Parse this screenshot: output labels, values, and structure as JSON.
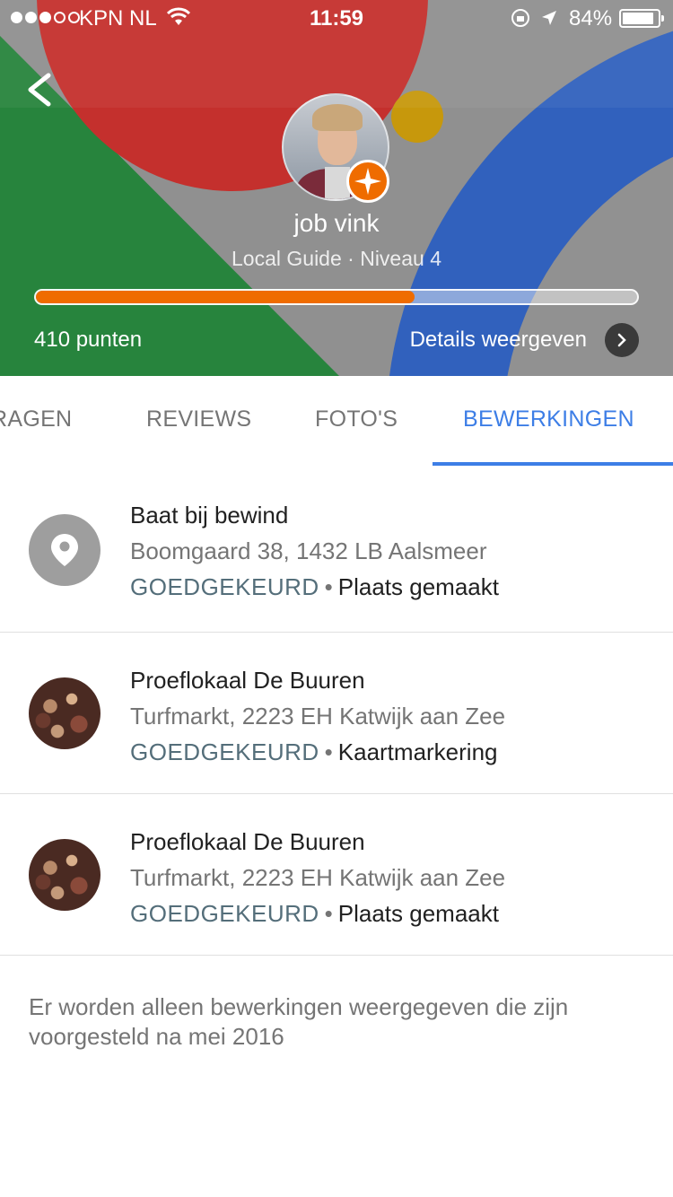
{
  "status_bar": {
    "carrier": "KPN NL",
    "time": "11:59",
    "battery": "84%",
    "battery_level": 0.84
  },
  "profile": {
    "name": "job vink",
    "level": "Local Guide · Niveau 4",
    "progress": 0.63,
    "points": "410 punten",
    "details_link": "Details weergeven",
    "progress_color": "#ef6c00"
  },
  "tabs": [
    {
      "label": "VRAGEN",
      "visible_text": "RAGEN",
      "active": false
    },
    {
      "label": "REVIEWS",
      "active": false
    },
    {
      "label": "FOTO'S",
      "active": false
    },
    {
      "label": "BEWERKINGEN",
      "active": true
    }
  ],
  "accent_color": "#3d7ee6",
  "edits": [
    {
      "title": "Baat bij bewind",
      "address": "Boomgaard 38, 1432 LB Aalsmeer",
      "status": "GOEDGEKEURD",
      "separator": "•",
      "kind": "Plaats gemaakt",
      "icon": "location-pin-icon"
    },
    {
      "title": "Proeflokaal De Buuren",
      "address": "Turfmarkt, 2223 EH Katwijk aan Zee",
      "status": "GOEDGEKEURD",
      "separator": "•",
      "kind": "Kaartmarkering",
      "icon": "place-photo"
    },
    {
      "title": "Proeflokaal De Buuren",
      "address": "Turfmarkt, 2223 EH Katwijk aan Zee",
      "status": "GOEDGEKEURD",
      "separator": "•",
      "kind": "Plaats gemaakt",
      "icon": "place-photo"
    }
  ],
  "footnote": "Er worden alleen bewerkingen weergegeven die zijn voorgesteld na mei 2016"
}
